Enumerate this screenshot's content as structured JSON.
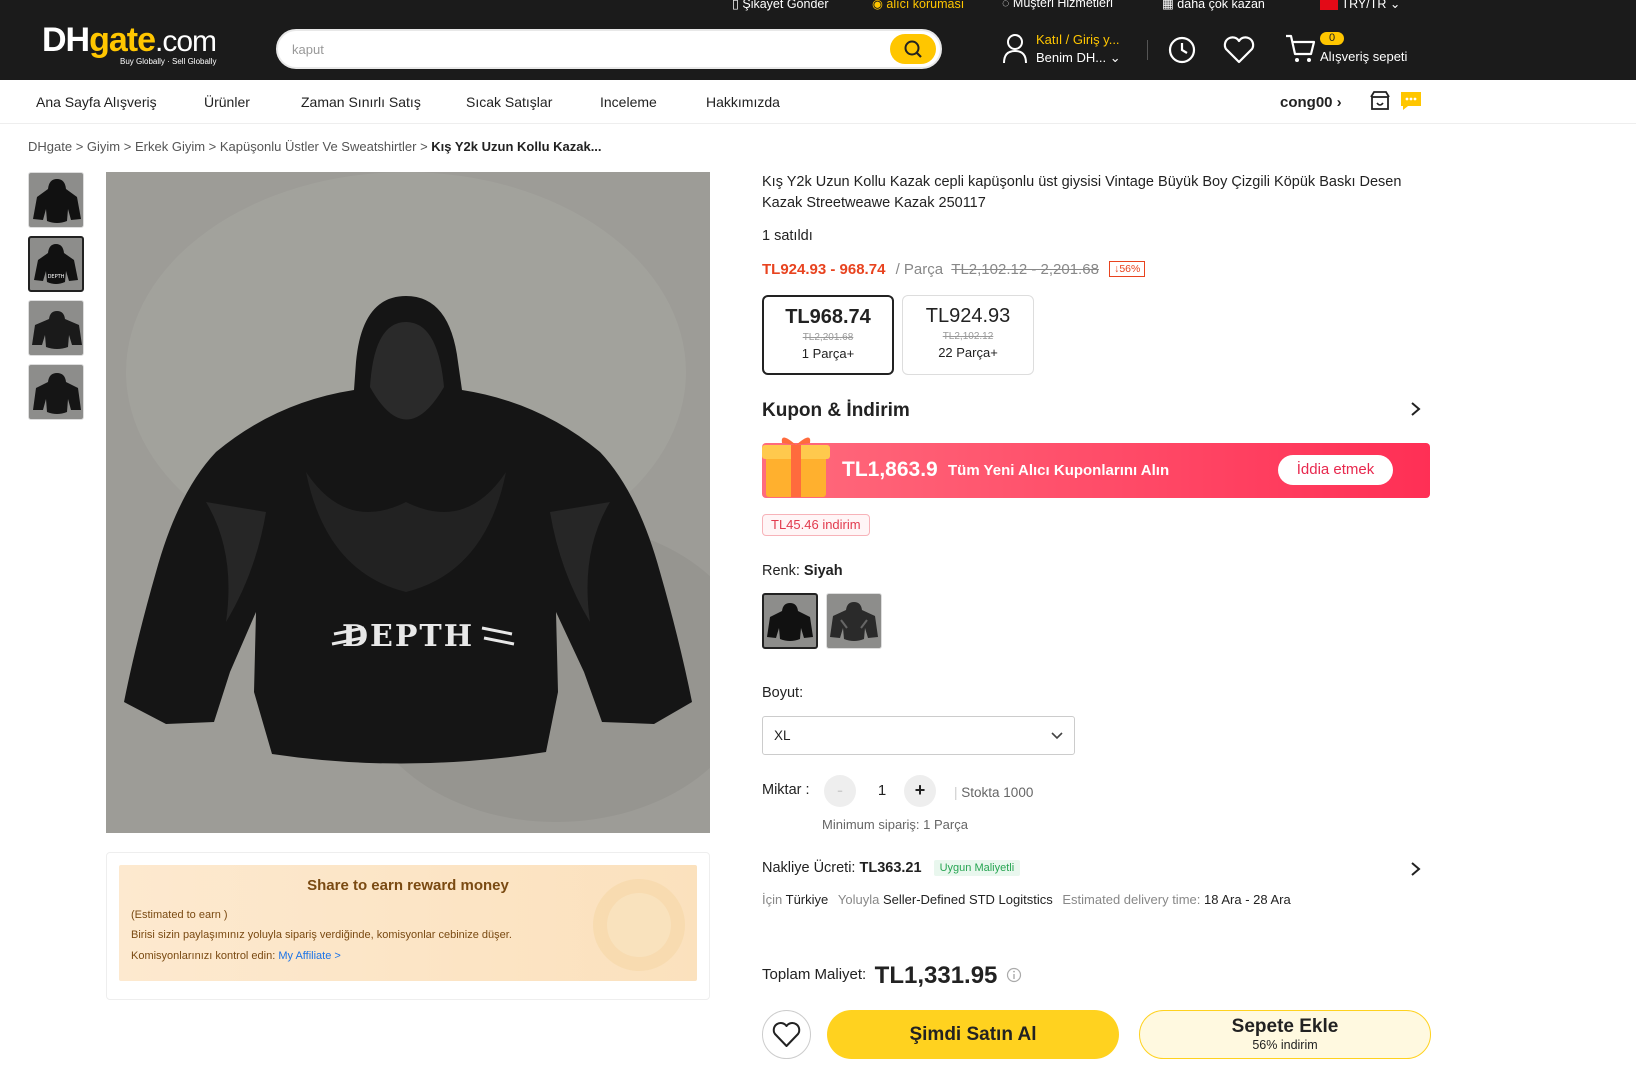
{
  "util_bar": {
    "complaint": "Şikayet Gönder",
    "buyer_protection": "alıcı koruması",
    "customer_service": "Müşteri Hizmetleri",
    "earn_more": "daha çok kazan",
    "locale": "TRY/TR"
  },
  "logo": {
    "dh": "DH",
    "gate": "gate",
    "com": ".com",
    "tagline": "Buy Globally · Sell Globally"
  },
  "search": {
    "value": "kaput"
  },
  "account": {
    "line1": "Katıl / Giriş y...",
    "line2": "Benim DH..."
  },
  "cart": {
    "count": "0",
    "label": "Alışveriş sepeti"
  },
  "nav": {
    "items": [
      "Ana Sayfa Alışveriş",
      "Ürünler",
      "Zaman Sınırlı Satış",
      "Sıcak Satışlar",
      "Inceleme",
      "Hakkımızda"
    ],
    "store": "cong00"
  },
  "breadcrumb": {
    "parts": [
      "DHgate",
      "Giyim",
      "Erkek Giyim",
      "Kapüşonlu Üstler Ve Sweatshirtler"
    ],
    "current": "Kış Y2k Uzun Kollu Kazak...",
    "sep": ">"
  },
  "product": {
    "title": "Kış Y2k Uzun Kollu Kazak cepli kapüşonlu üst giysisi Vintage Büyük Boy Çizgili Köpük Baskı Desen Kazak Streetweawe Kazak 250117",
    "sold": "1 satıldı",
    "price_range": "TL924.93 - 968.74",
    "unit": "/ Parça",
    "orig_range": "TL2,102.12 - 2,201.68",
    "discount": "↓56%",
    "image_text": "DEPTH"
  },
  "tiers": [
    {
      "price": "TL968.74",
      "orig": "TL2,201.68",
      "qty": "1 Parça+"
    },
    {
      "price": "TL924.93",
      "orig": "TL2,102.12",
      "qty": "22 Parça+"
    }
  ],
  "coupon": {
    "heading": "Kupon & İndirim",
    "amount": "TL1,863.9",
    "text": "Tüm Yeni Alıcı Kuponlarını Alın",
    "claim": "İddia etmek",
    "discount_pill": "TL45.46 indirim"
  },
  "color": {
    "label": "Renk:",
    "value": "Siyah"
  },
  "size": {
    "label": "Boyut:",
    "value": "XL"
  },
  "qty": {
    "label": "Miktar :",
    "minus": "-",
    "value": "1",
    "plus": "+",
    "stock": "Stokta 1000",
    "min": "Minimum sipariş: 1 Parça"
  },
  "shipping": {
    "label": "Nakliye Ücreti:",
    "price": "TL363.21",
    "badge": "Uygun Maliyetli",
    "for": "İçin",
    "country": "Türkiye",
    "via": "Yoluyla",
    "method": "Seller-Defined STD Logitstics",
    "eta_label": "Estimated delivery time:",
    "eta": "18 Ara - 28 Ara"
  },
  "total": {
    "label": "Toplam Maliyet:",
    "value": "TL1,331.95"
  },
  "actions": {
    "buy": "Şimdi Satın Al",
    "cart": "Sepete Ekle",
    "cart_sub": "56% indirim"
  },
  "share": {
    "title": "Share to earn reward money",
    "estimated": "(Estimated to earn )",
    "desc": "Birisi sizin paylaşımınız yoluyla sipariş verdiğinde, komisyonlar cebinize düşer.",
    "check": "Komisyonlarınızı kontrol edin:",
    "link": "My Affiliate >"
  },
  "colors": {
    "brand_yellow": "#ffc600",
    "price_red": "#e8431f",
    "header_bg": "#1b1b1b"
  }
}
